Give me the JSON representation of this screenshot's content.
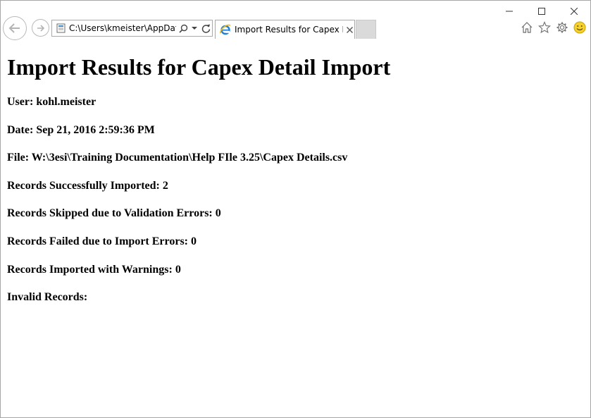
{
  "browser": {
    "address": "C:\\Users\\kmeister\\AppData\\",
    "tab_title": "Import Results for Capex De...",
    "icons": {
      "back": "back-arrow-icon",
      "forward": "forward-arrow-icon",
      "page": "page-icon",
      "search": "search-icon",
      "dropdown": "chevron-down-icon",
      "refresh": "refresh-icon",
      "tab": "ie-logo-icon",
      "close_tab": "close-icon",
      "home": "home-icon",
      "favorites": "star-icon",
      "settings": "gear-icon",
      "feedback": "smiley-icon",
      "minimize": "minimize-icon",
      "maximize": "maximize-icon",
      "close_window": "close-icon"
    },
    "accent_color": "#1e7fd6"
  },
  "page": {
    "title": "Import Results for Capex Detail Import",
    "user": "User: kohl.meister",
    "date": "Date: Sep 21, 2016 2:59:36 PM",
    "file": "File: W:\\3esi\\Training Documentation\\Help FIle 3.25\\Capex Details.csv",
    "success": "Records Successfully Imported: 2",
    "skipped": "Records Skipped due to Validation Errors: 0",
    "failed": "Records Failed due to Import Errors: 0",
    "warnings": "Records Imported with Warnings: 0",
    "invalid": "Invalid Records:"
  }
}
